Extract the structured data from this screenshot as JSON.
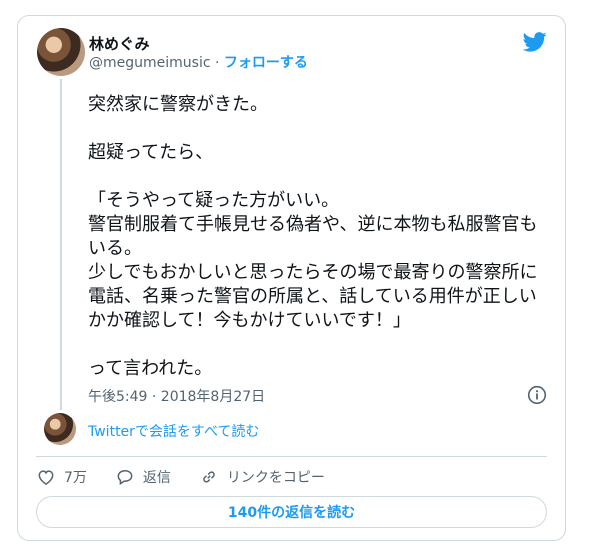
{
  "author": {
    "name": "林めぐみ",
    "handle": "@megumeimusic",
    "separator": "·",
    "follow_label": "フォローする"
  },
  "tweet": {
    "paragraphs": [
      "突然家に警察がきた。",
      "超疑ってたら、",
      "「そうやって疑った方がいい。\n警官制服着て手帳見せる偽者や、逆に本物も私服警官もいる。\n少しでもおかしいと思ったらその場で最寄りの警察所に電話、名乗った警官の所属と、話している用件が正しいかか確認して！今もかけていいです！」",
      "って言われた。"
    ],
    "timestamp": "午後5:49 · 2018年8月27日"
  },
  "thread": {
    "read_all_label": "Twitterで会話をすべて読む"
  },
  "actions": {
    "like_count": "7万",
    "reply_label": "返信",
    "copy_link_label": "リンクをコピー"
  },
  "replies_button_label": "140件の返信を読む",
  "icons": {
    "brand": "twitter-bird-icon",
    "info": "info-icon",
    "like": "heart-icon",
    "reply": "speech-bubble-icon",
    "link": "link-icon"
  },
  "colors": {
    "accent": "#1d9bf0",
    "text": "#0f1419",
    "muted": "#536471",
    "border": "#cfd9de"
  }
}
